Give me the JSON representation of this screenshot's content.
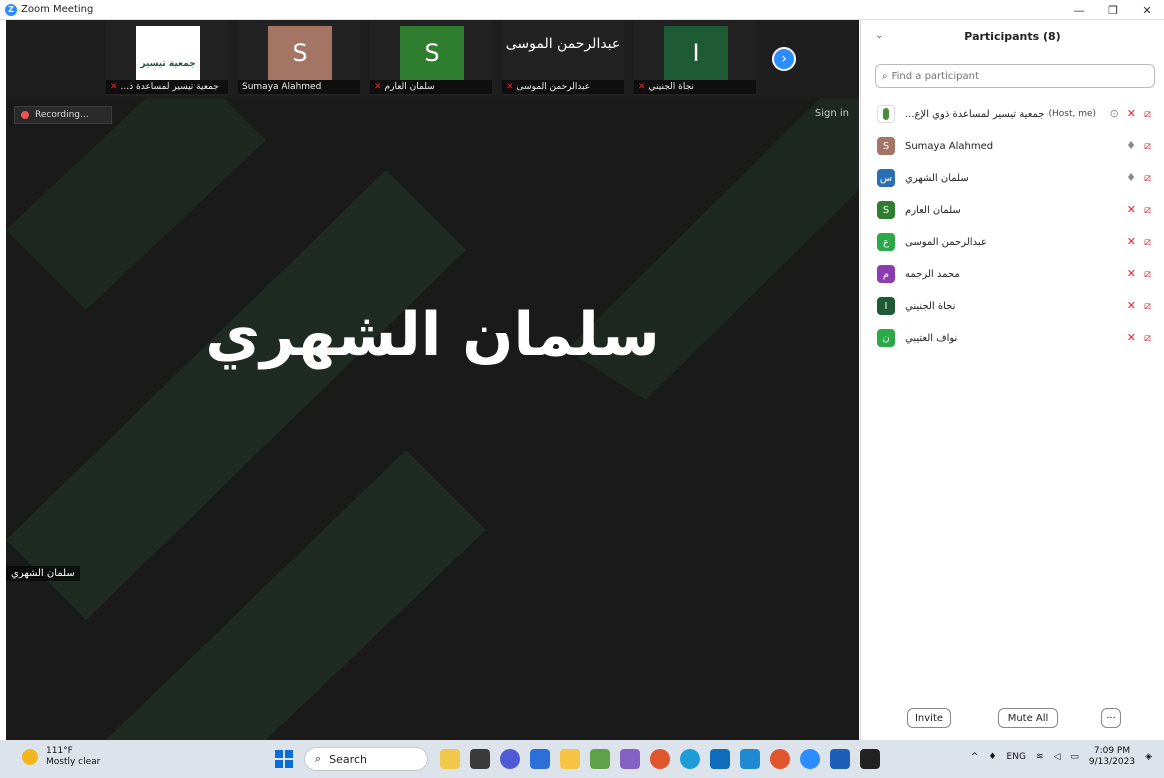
{
  "window": {
    "title": "Zoom Meeting",
    "minimize": "—",
    "restore": "❐",
    "close": "✕"
  },
  "thumbnails": [
    {
      "name": "جمعية تيسير لمساعدة ذ...",
      "tile_text": "جمعية تيسير",
      "color": "#ffffff"
    },
    {
      "name": "Sumaya Alahmed",
      "tile_text": "S",
      "color": "#a47464"
    },
    {
      "name": "سلمان العارم",
      "tile_text": "S",
      "color": "#2f7d2f"
    },
    {
      "name": "عبدالرحمن الموسى",
      "tile_text": "عبدالرحمن الموسى",
      "color": "#222222"
    },
    {
      "name": "نجاة الجنيني",
      "tile_text": "I",
      "color": "#1e5a34"
    }
  ],
  "next_arrow": "›",
  "recording_label": "Recording...",
  "signin_label": "Sign in",
  "active_speaker": {
    "big_name": "سلمان الشهري",
    "label": "سلمان الشهري"
  },
  "panel": {
    "title": "Participants (8)",
    "collapse": "⌄",
    "search_placeholder": "Find a participant",
    "participants": [
      {
        "name": "جمعية تيسير لمساعدة ذوي الإع...",
        "tag": "(Host, me)",
        "avatar": "",
        "color": "#ffffff",
        "mic": "muted",
        "video": "off"
      },
      {
        "name": "Sumaya Alahmed",
        "tag": "",
        "avatar": "S",
        "color": "#a47464",
        "mic": "on",
        "video": "off"
      },
      {
        "name": "سلمان الشهري",
        "tag": "",
        "avatar": "س",
        "color": "#2a6fb5",
        "mic": "speaking",
        "video": "off"
      },
      {
        "name": "سلمان العارم",
        "tag": "",
        "avatar": "S",
        "color": "#2f7d2f",
        "mic": "muted",
        "video": "off"
      },
      {
        "name": "عبدالرحمن الموسى",
        "tag": "",
        "avatar": "ع",
        "color": "#2aa84a",
        "mic": "muted",
        "video": "off"
      },
      {
        "name": "محمد الرجمه",
        "tag": "",
        "avatar": "م",
        "color": "#8b3db0",
        "mic": "muted",
        "video": "off"
      },
      {
        "name": "نجاة الجنيني",
        "tag": "",
        "avatar": "I",
        "color": "#1e5a34",
        "mic": "muted",
        "video": "off"
      },
      {
        "name": "نواف العتيبي",
        "tag": "",
        "avatar": "ن",
        "color": "#2aa84a",
        "mic": "muted",
        "video": "off"
      }
    ],
    "invite_label": "Invite",
    "mute_all_label": "Mute All",
    "more_label": "···"
  },
  "taskbar": {
    "weather_temp": "111°F",
    "weather_desc": "Mostly clear",
    "search_label": "Search",
    "lang": "ENG",
    "time": "7:09 PM",
    "date": "9/13/2023"
  },
  "colors": {
    "meeting_bg": "#1a1a1a",
    "accent": "#2d8cff",
    "muted_red": "#e02828"
  }
}
